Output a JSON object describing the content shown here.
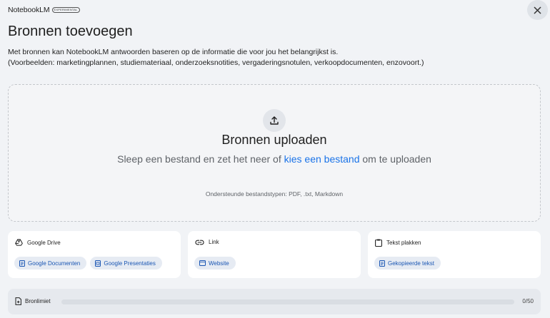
{
  "header": {
    "brand": "NotebookLM",
    "badge": "EXPERIMENTAL",
    "close_icon": "close-icon"
  },
  "page": {
    "title": "Bronnen toevoegen",
    "description_line1": "Met bronnen kan NotebookLM antwoorden baseren op de informatie die voor jou het belangrijkst is.",
    "description_line2": "(Voorbeelden: marketingplannen, studiemateriaal, onderzoeksnotities, vergaderingsnotulen, verkoopdocumenten, enzovoort.)"
  },
  "upload": {
    "icon": "upload-icon",
    "title": "Bronnen uploaden",
    "hint_before": "Sleep een bestand en zet het neer of ",
    "hint_link": "kies een bestand",
    "hint_after": " om te uploaden",
    "supported_types": "Ondersteunde bestandstypen: PDF, .txt, Markdown"
  },
  "cards": [
    {
      "icon": "drive-icon",
      "label": "Google Drive",
      "chips": [
        {
          "icon": "document-icon",
          "label": "Google Documenten"
        },
        {
          "icon": "slides-icon",
          "label": "Google Presentaties"
        }
      ]
    },
    {
      "icon": "link-icon",
      "label": "Link",
      "chips": [
        {
          "icon": "website-icon",
          "label": "Website"
        }
      ]
    },
    {
      "icon": "clipboard-icon",
      "label": "Tekst plakken",
      "chips": [
        {
          "icon": "document-icon",
          "label": "Gekopieerde tekst"
        }
      ]
    }
  ],
  "source_limit": {
    "icon": "source-limit-icon",
    "label": "Bronlimiet",
    "count": "0/50",
    "progress": 0
  },
  "colors": {
    "accent": "#1a73e8",
    "background": "#f1f3f6",
    "card": "#ffffff",
    "chip": "#e6ebf3"
  }
}
